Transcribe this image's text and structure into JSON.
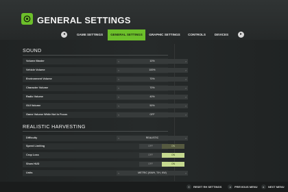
{
  "header": {
    "title": "GENERAL SETTINGS",
    "logo_icon": "nvidia-eye-icon",
    "accent_color": "#6cbf2a"
  },
  "tabs": {
    "prev_key": "◂",
    "next_key": "▸",
    "items": [
      {
        "label": "GAME SETTINGS",
        "active": false
      },
      {
        "label": "GENERAL SETTINGS",
        "active": true
      },
      {
        "label": "GRAPHIC SETTINGS",
        "active": false
      },
      {
        "label": "CONTROLS",
        "active": false
      },
      {
        "label": "DEVICES",
        "active": false
      }
    ]
  },
  "sound": {
    "title": "SOUND",
    "rows": [
      {
        "label": "Volume Master",
        "value": "10%"
      },
      {
        "label": "Vehicle Volume",
        "value": "100%"
      },
      {
        "label": "Environment Volume",
        "value": "70%"
      },
      {
        "label": "Character Volume",
        "value": "70%"
      },
      {
        "label": "Radio Volume",
        "value": "40%"
      },
      {
        "label": "GUI Volume",
        "value": "50%"
      },
      {
        "label": "Game Volume While Not In Focus",
        "value": "OFF"
      }
    ]
  },
  "harvesting": {
    "title": "REALISTIC HARVESTING",
    "difficulty": {
      "label": "Difficulty",
      "value": "REALISTIC"
    },
    "toggles": [
      {
        "label": "Speed Limiting",
        "off": "OFF",
        "on": "ON",
        "highlight": false
      },
      {
        "label": "Crop Loss",
        "off": "OFF",
        "on": "ON",
        "highlight": true
      },
      {
        "label": "Show HUD",
        "off": "OFF",
        "on": "ON",
        "highlight": true
      }
    ],
    "units": {
      "label": "Units",
      "value": "METRIC (KM/H, T/H, KW)"
    }
  },
  "footer": {
    "items": [
      {
        "key": "X",
        "label": "RESET RH SETTINGS"
      },
      {
        "key": "◂",
        "label": "PREVIOUS MENU"
      },
      {
        "key": "▸",
        "label": "NEXT MENU"
      }
    ]
  }
}
